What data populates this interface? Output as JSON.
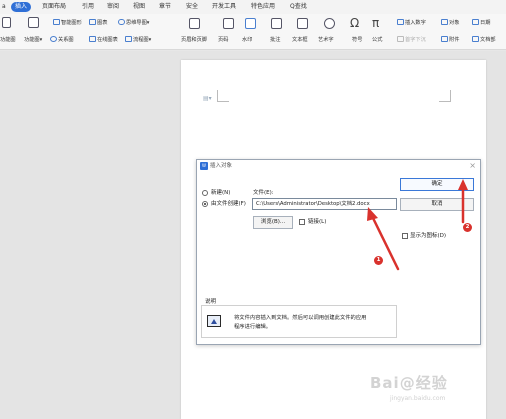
{
  "ribbon_tabs": [
    {
      "label": "a"
    },
    {
      "label": "插入"
    },
    {
      "label": "页面布局"
    },
    {
      "label": "引用"
    },
    {
      "label": "审阅"
    },
    {
      "label": "视图"
    },
    {
      "label": "章节"
    },
    {
      "label": "安全"
    },
    {
      "label": "开发工具"
    },
    {
      "label": "特色应用"
    },
    {
      "label": "Q查找"
    }
  ],
  "ribbon": {
    "smartart": "智能图形",
    "chart": "图表",
    "mindmap": "思维导图",
    "mindmap_arrow": "▾",
    "cut_1": "功能图",
    "function": "功能图",
    "function_arrow": "▾",
    "relation": "关系图",
    "online_chart": "在线图表",
    "flowchart": "流程图",
    "flowchart_arrow": "▾",
    "header_footer": "页眉和页脚",
    "page_number": "页码",
    "watermark": "水印",
    "comment": "批注",
    "textbox": "文本框",
    "wordart": "艺术字",
    "symbol": "符号",
    "formula": "公式",
    "insert_number": "插入数字",
    "object": "对象",
    "date": "日期",
    "first_drop": "首字下沉",
    "attachment": "附件",
    "docpart": "文档部"
  },
  "dialog": {
    "title": "插入对象",
    "close": "×",
    "new_label": "新建(N)",
    "from_file_label": "由文件创建(F)",
    "file_caption": "文件(E):",
    "file_path": "C:\\Users\\Administrator\\Desktop\\文档2.docx",
    "browse": "浏览(B)...",
    "link": "链接(L)",
    "ok": "确定",
    "cancel": "取消",
    "show_as_icon": "显示为图标(D)",
    "desc_title": "说明",
    "desc_text_1": "将文件内容插入到文档。然后可以调用创建此文件的应用",
    "desc_text_2": "程序进行编辑。"
  },
  "annotations": {
    "badge_1": "1",
    "badge_2": "2",
    "color": "#d9322d"
  },
  "watermark": {
    "main": "Bai@经验",
    "sub": "jingyan.baidu.com"
  }
}
